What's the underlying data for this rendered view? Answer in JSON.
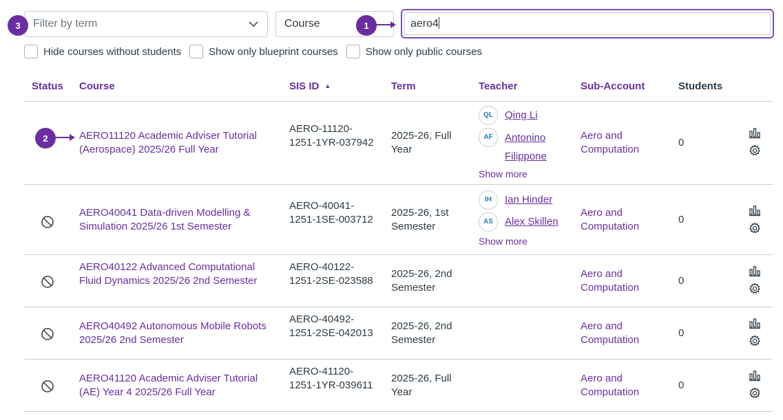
{
  "filters": {
    "term_placeholder": "Filter by term",
    "search_type": "Course",
    "search_value": "aero4"
  },
  "annotations": [
    "1",
    "2",
    "3"
  ],
  "checkboxes": [
    {
      "label": "Hide courses without students",
      "checked": false
    },
    {
      "label": "Show only blueprint courses",
      "checked": false
    },
    {
      "label": "Show only public courses",
      "checked": false
    }
  ],
  "table": {
    "headers": {
      "status": "Status",
      "course": "Course",
      "sis_id": "SIS ID",
      "term": "Term",
      "teacher": "Teacher",
      "sub_account": "Sub-Account",
      "students": "Students"
    },
    "sort_indicator": "▲",
    "rows": [
      {
        "course": "AERO11120 Academic Adviser Tutorial (Aerospace) 2025/26 Full Year",
        "sis_id": "AERO-11120-1251-1YR-037942",
        "term": "2025-26, Full Year",
        "teachers": [
          {
            "initials": "QL",
            "name": "Qing Li"
          },
          {
            "initials": "AF",
            "name": "Antonino Filippone"
          }
        ],
        "show_more": "Show more",
        "sub_account": "Aero and Computation",
        "students": "0"
      },
      {
        "course": "AERO40041 Data-driven Modelling & Simulation 2025/26 1st Semester",
        "sis_id": "AERO-40041-1251-1SE-003712",
        "term": "2025-26, 1st Semester",
        "teachers": [
          {
            "initials": "IH",
            "name": "Ian Hinder"
          },
          {
            "initials": "AS",
            "name": "Alex Skillen"
          }
        ],
        "show_more": "Show more",
        "sub_account": "Aero and Computation",
        "students": "0"
      },
      {
        "course": "AERO40122 Advanced Computational Fluid Dynamics 2025/26 2nd Semester",
        "sis_id": "AERO-40122-1251-2SE-023588",
        "term": "2025-26, 2nd Semester",
        "teachers": [],
        "show_more": "",
        "sub_account": "Aero and Computation",
        "students": "0"
      },
      {
        "course": "AERO40492 Autonomous Mobile Robots 2025/26 2nd Semester",
        "sis_id": "AERO-40492-1251-2SE-042013",
        "term": "2025-26, 2nd Semester",
        "teachers": [],
        "show_more": "",
        "sub_account": "Aero and Computation",
        "students": "0"
      },
      {
        "course": "AERO41120 Academic Adviser Tutorial (AE) Year 4 2025/26 Full Year",
        "sis_id": "AERO-41120-1251-1YR-039611",
        "term": "2025-26, Full Year",
        "teachers": [],
        "show_more": "",
        "sub_account": "Aero and Computation",
        "students": "0"
      }
    ]
  },
  "colors": {
    "accent": "#6a2ea0",
    "annotation": "#6a2ea0",
    "text": "#2d3b45",
    "border": "#c7cdd1",
    "initials": "#2b7abc"
  },
  "icons": {
    "status": "unpublished-icon",
    "stats": "bar-chart-icon",
    "settings": "gear-icon",
    "dropdown": "chevron-down-icon"
  }
}
